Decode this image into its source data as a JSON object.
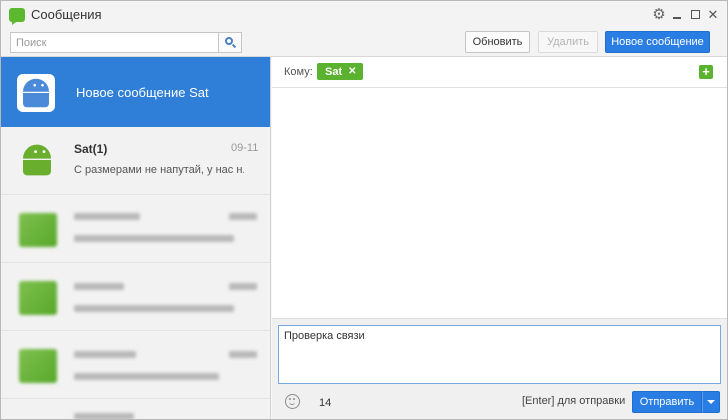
{
  "window": {
    "title": "Сообщения"
  },
  "toolbar": {
    "search_placeholder": "Поиск",
    "refresh_label": "Обновить",
    "delete_label": "Удалить",
    "new_message_label": "Новое сообщение"
  },
  "sidebar": {
    "active_item": {
      "title": "Новое сообщение Sat"
    },
    "items": [
      {
        "name": "Sat(1)",
        "date": "09-11",
        "preview": "С размерами не напутай, у нас н..."
      }
    ]
  },
  "compose": {
    "to_label": "Кому:",
    "recipients": [
      {
        "name": "Sat"
      }
    ],
    "message_text": "Проверка связи",
    "char_count": "14",
    "enter_hint": "[Enter] для отправки",
    "send_label": "Отправить"
  },
  "colors": {
    "accent": "#2a7ee3",
    "selection": "#2f7ed8",
    "green": "#5ab22e"
  },
  "icons": [
    "messages-app-icon",
    "gear-icon",
    "minimize-icon",
    "maximize-icon",
    "close-icon",
    "search-icon",
    "android-icon",
    "remove-recipient-icon",
    "add-recipient-icon",
    "emoji-icon",
    "dropdown-arrow-icon"
  ]
}
